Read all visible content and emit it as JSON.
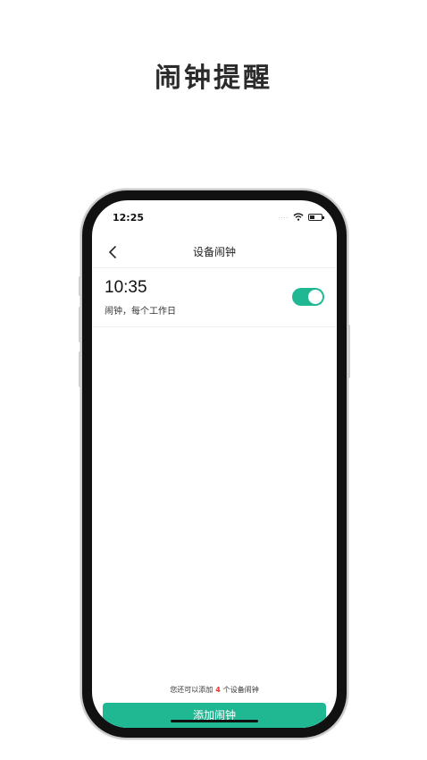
{
  "promo": {
    "title": "闹钟提醒"
  },
  "status_bar": {
    "time": "12:25",
    "signal": "....",
    "icons": [
      "wifi-icon",
      "battery-icon"
    ]
  },
  "nav": {
    "title": "设备闹钟",
    "back_icon": "chevron-left-icon"
  },
  "alarms": [
    {
      "time": "10:35",
      "description": "闹钟，每个工作日",
      "enabled": true
    }
  ],
  "footer": {
    "note_prefix": "您还可以添加",
    "remaining_count": "4",
    "note_suffix": "个设备闹钟",
    "add_button_label": "添加闹钟"
  },
  "colors": {
    "accent": "#1fb893",
    "count_highlight": "#e53935"
  }
}
